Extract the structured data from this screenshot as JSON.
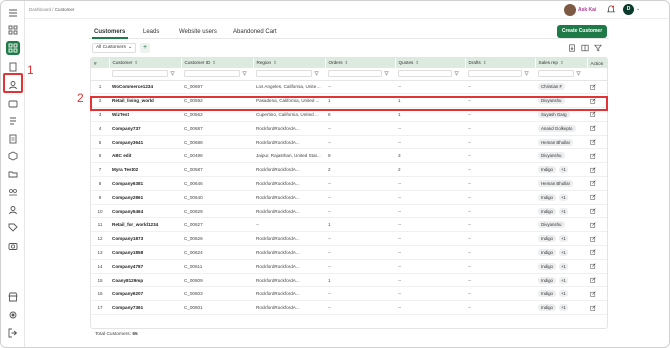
{
  "breadcrumb": {
    "root": "Dashboard",
    "sep": "/",
    "current": "Customer"
  },
  "user": {
    "name": "Ask Kai",
    "initial": "D"
  },
  "tabs": [
    {
      "label": "Customers",
      "active": true
    },
    {
      "label": "Leads",
      "active": false
    },
    {
      "label": "Website users",
      "active": false
    },
    {
      "label": "Abandoned Cart",
      "active": false
    }
  ],
  "actions": {
    "create_label": "Create Customer"
  },
  "filter": {
    "selected": "All Customers"
  },
  "annotations": {
    "one": "1",
    "two": "2"
  },
  "colors": {
    "brand": "#1e7a46",
    "highlight": "#e23434",
    "header_bg": "#dceadf"
  },
  "table": {
    "columns": [
      "#",
      "Customer",
      "Customer ID",
      "Region",
      "Orders",
      "Quotes",
      "Drafts",
      "Sales rep",
      "Action"
    ],
    "rows": [
      {
        "n": "1",
        "customer": "WoCommerce1234",
        "id": "C_00697",
        "region": "Los Angeles, California, United ...",
        "orders": "--",
        "quotes": "--",
        "drafts": "--",
        "rep": "Christian F",
        "extra": ""
      },
      {
        "n": "2",
        "customer": "Retail_living_world",
        "id": "C_00592",
        "region": "Pasadena, California, United ...",
        "orders": "1",
        "quotes": "1",
        "drafts": "--",
        "rep": "Divyanshu",
        "extra": ""
      },
      {
        "n": "3",
        "customer": "WizTest",
        "id": "C_00562",
        "region": "Cupertino, California, United ...",
        "orders": "6",
        "quotes": "1",
        "drafts": "--",
        "rep": "Suyash Garg",
        "extra": ""
      },
      {
        "n": "4",
        "customer": "Company737",
        "id": "C_00687",
        "region": "RockfordRockfordA...",
        "orders": "--",
        "quotes": "--",
        "drafts": "--",
        "rep": "Anand Golkepto",
        "extra": ""
      },
      {
        "n": "5",
        "customer": "Company3641",
        "id": "C_00688",
        "region": "RockfordRockfordA...",
        "orders": "--",
        "quotes": "--",
        "drafts": "--",
        "rep": "Heman Bhullar",
        "extra": ""
      },
      {
        "n": "6",
        "customer": "ABC edit",
        "id": "C_00498",
        "region": "Jaipur, Rajasthan, United Stat...",
        "orders": "9",
        "quotes": "3",
        "drafts": "--",
        "rep": "Divyanshu",
        "extra": ""
      },
      {
        "n": "7",
        "customer": "Myra Test02",
        "id": "C_00587",
        "region": "RockfordRockfordA...",
        "orders": "2",
        "quotes": "2",
        "drafts": "--",
        "rep": "Indigo",
        "extra": "+1"
      },
      {
        "n": "8",
        "customer": "Company6381",
        "id": "C_00646",
        "region": "RockfordRockfordA...",
        "orders": "--",
        "quotes": "--",
        "drafts": "--",
        "rep": "Heman Bhullar",
        "extra": ""
      },
      {
        "n": "9",
        "customer": "Company2861",
        "id": "C_00640",
        "region": "RockfordRockfordA...",
        "orders": "--",
        "quotes": "--",
        "drafts": "--",
        "rep": "Indigo",
        "extra": "+1"
      },
      {
        "n": "10",
        "customer": "Company5464",
        "id": "C_00629",
        "region": "RockfordRockfordA...",
        "orders": "--",
        "quotes": "--",
        "drafts": "--",
        "rep": "Indigo",
        "extra": "+1"
      },
      {
        "n": "11",
        "customer": "Retail_for_world1234",
        "id": "C_00627",
        "region": "--",
        "orders": "1",
        "quotes": "--",
        "drafts": "--",
        "rep": "Divyanshu",
        "extra": ""
      },
      {
        "n": "12",
        "customer": "Company1873",
        "id": "C_00626",
        "region": "RockfordRockfordA...",
        "orders": "--",
        "quotes": "--",
        "drafts": "--",
        "rep": "Indigo",
        "extra": "+1"
      },
      {
        "n": "13",
        "customer": "Company1858",
        "id": "C_00624",
        "region": "RockfordRockfordA...",
        "orders": "--",
        "quotes": "--",
        "drafts": "--",
        "rep": "Indigo",
        "extra": "+1"
      },
      {
        "n": "14",
        "customer": "Company4787",
        "id": "C_00611",
        "region": "RockfordRockfordA...",
        "orders": "--",
        "quotes": "--",
        "drafts": "--",
        "rep": "Indigo",
        "extra": "+1"
      },
      {
        "n": "15",
        "customer": "Coany8129mp",
        "id": "C_00609",
        "region": "RockfordRockfordA...",
        "orders": "1",
        "quotes": "--",
        "drafts": "--",
        "rep": "Indigo",
        "extra": "+1"
      },
      {
        "n": "16",
        "customer": "Company6207",
        "id": "C_00603",
        "region": "RockfordRockfordA...",
        "orders": "--",
        "quotes": "--",
        "drafts": "--",
        "rep": "Indigo",
        "extra": "+1"
      },
      {
        "n": "17",
        "customer": "Company7361",
        "id": "C_00601",
        "region": "RockfordRockfordA...",
        "orders": "--",
        "quotes": "--",
        "drafts": "--",
        "rep": "Indigo",
        "extra": "+1"
      }
    ]
  },
  "footer": {
    "label": "Total Customers:",
    "count": "65"
  },
  "sidebar": {
    "icons": [
      "menu-icon",
      "apps-icon",
      "dashboard-icon",
      "catalog-icon",
      "customers-icon",
      "orders-icon",
      "quotes-icon",
      "invoices-icon",
      "shipments-icon",
      "files-icon",
      "accounts-icon",
      "users-icon",
      "tags-icon",
      "camera-icon",
      "storefront-icon",
      "settings-icon",
      "logout-icon"
    ]
  }
}
